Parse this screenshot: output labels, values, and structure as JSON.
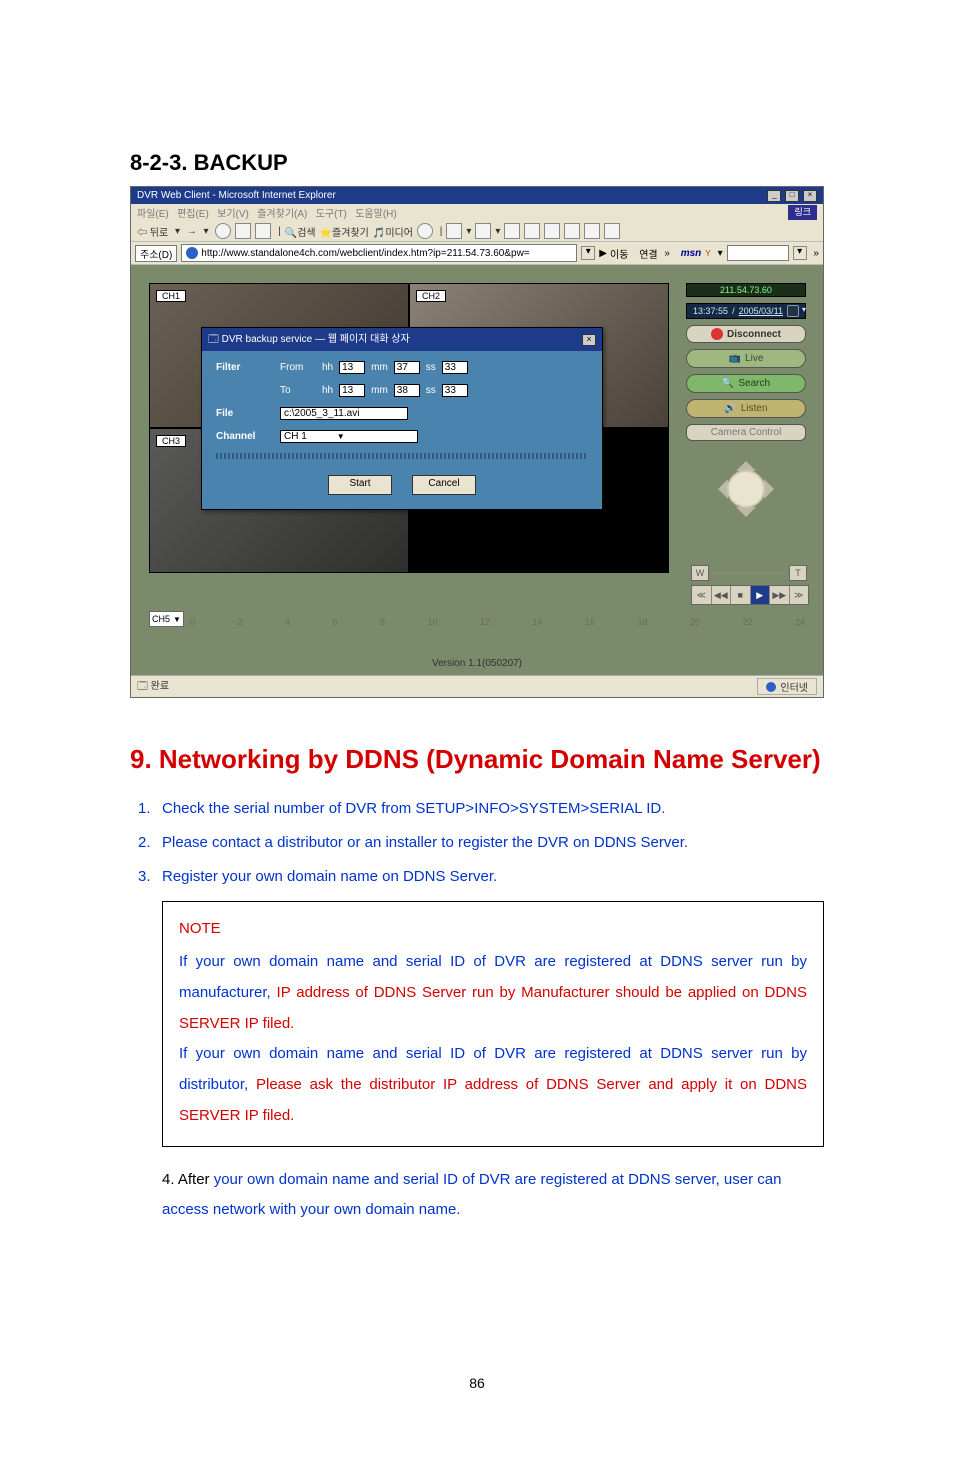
{
  "section_heading": "8-2-3. BACKUP",
  "ie": {
    "title": "DVR Web Client - Microsoft Internet Explorer",
    "menus": [
      "파일(E)",
      "편집(E)",
      "보기(V)",
      "즐겨찾기(A)",
      "도구(T)",
      "도움말(H)"
    ],
    "right_menu": "링크",
    "toolbar": {
      "back": "뒤로",
      "search": "검색",
      "favorites": "즐겨찾기",
      "media": "미디어"
    },
    "addr_label": "주소(D)",
    "url": "http://www.standalone4ch.com/webclient/index.htm?ip=211.54.73.60&pw=",
    "go": "이동",
    "links": "연결",
    "msn": "msn"
  },
  "channels": {
    "ch1": "CH1",
    "ch2": "CH2",
    "ch3": "CH3"
  },
  "dialog": {
    "title": "DVR backup service — 웹 페이지 대화 상자",
    "filter": "Filter",
    "from": "From",
    "to": "To",
    "hh_label": "hh",
    "mm_label": "mm",
    "ss_label": "ss",
    "from_hh": "13",
    "from_mm": "37",
    "from_ss": "33",
    "to_hh": "13",
    "to_mm": "38",
    "to_ss": "33",
    "file": "File",
    "file_value": "c:\\2005_3_11.avi",
    "channel": "Channel",
    "channel_value": "CH 1",
    "start": "Start",
    "cancel": "Cancel"
  },
  "side": {
    "ip": "211.54.73.60",
    "datetime": {
      "time": "13:37:55",
      "date": "2005/03/11"
    },
    "disconnect": "Disconnect",
    "live": "Live",
    "search": "Search",
    "listen": "Listen",
    "camera": "Camera Control",
    "w": "W",
    "t": "T"
  },
  "timeline": {
    "ch_sel": "CH5",
    "ticks": [
      "0",
      "2",
      "4",
      "6",
      "8",
      "10",
      "12",
      "14",
      "16",
      "18",
      "20",
      "22",
      "24"
    ]
  },
  "version": "Version 1.1(050207)",
  "status": {
    "left_done": "완료",
    "internet": "인터넷"
  },
  "heading2": "9. Networking by DDNS (Dynamic Domain Name Server)",
  "steps": {
    "s1": "Check the serial number of DVR from SETUP>INFO>SYSTEM>SERIAL ID.",
    "s2": "Please contact a distributor or an installer to register the DVR on DDNS Server.",
    "s3": "Register your own domain name on DDNS Server."
  },
  "note": {
    "title": "NOTE",
    "p1a": "If your own domain name and serial ID of DVR are registered at DDNS server run by manufacturer,",
    "p1b": " IP address of DDNS Server run by Manufacturer should be applied on DDNS SERVER IP filed.",
    "p2a": "If your own domain name and serial ID of DVR are registered at DDNS server run by distributor,",
    "p2b": " Please ask the distributor IP address of DDNS Server and apply it on DDNS SERVER IP filed."
  },
  "step4": {
    "pre": "4.   After ",
    "blue": "your own domain name and serial ID of DVR are registered at DDNS server, user can access network with your own domain name."
  },
  "page_number": "86"
}
